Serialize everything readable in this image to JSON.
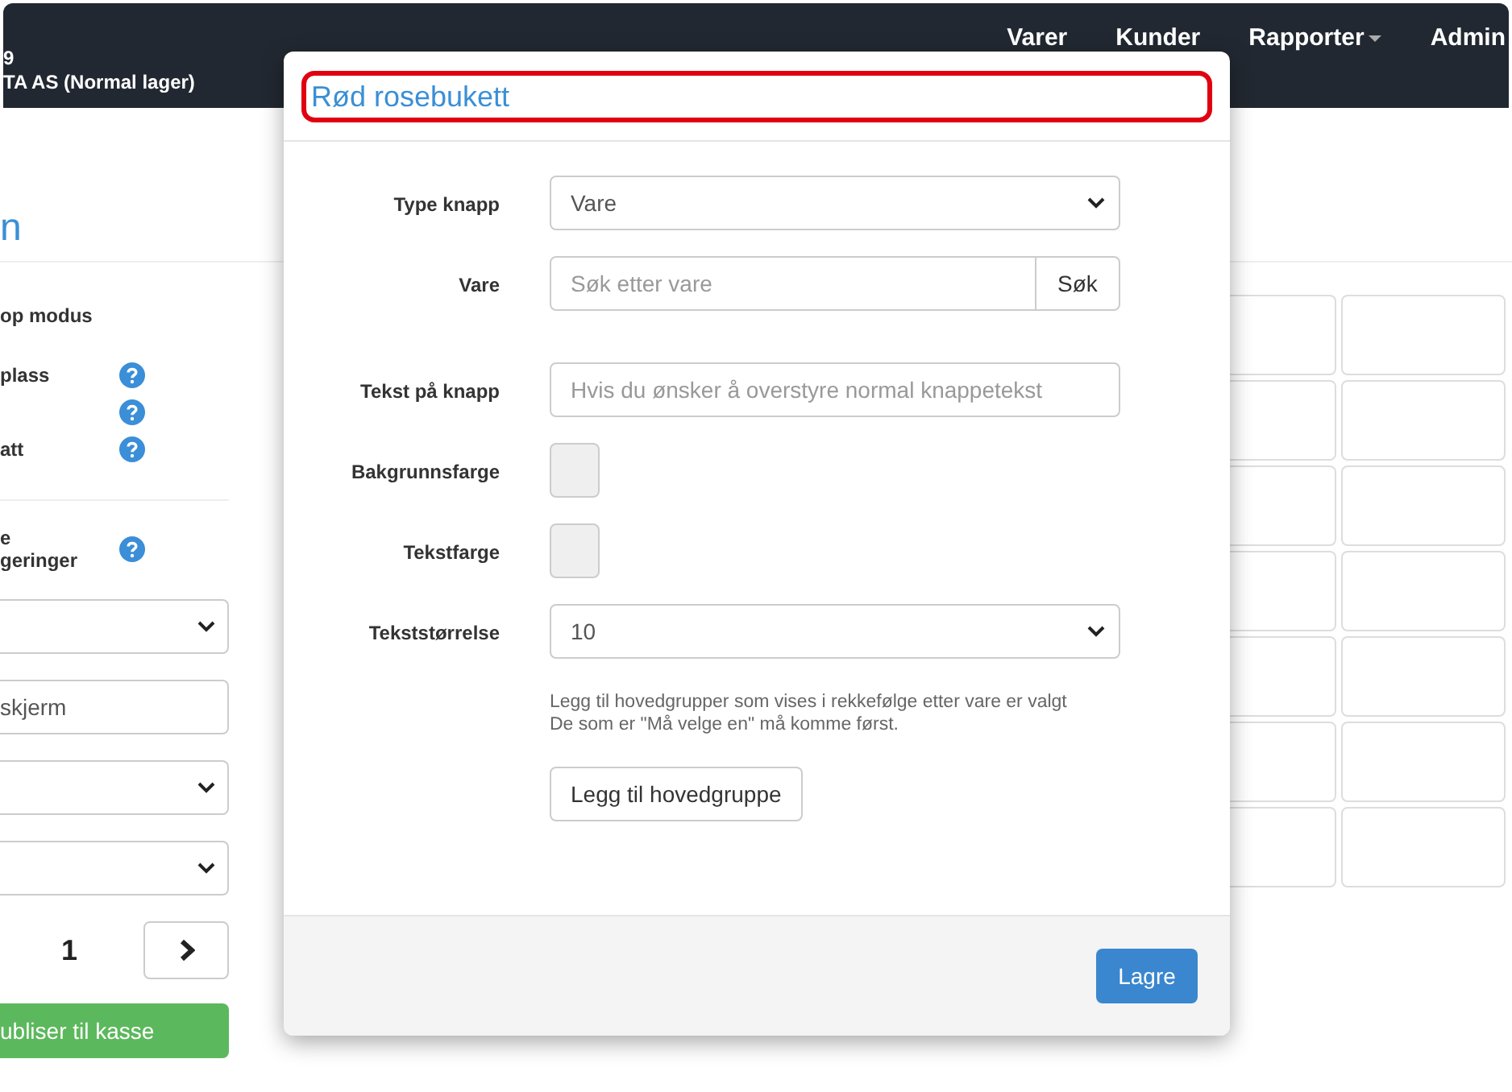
{
  "navbar": {
    "brand_lines": [
      "9",
      "TA AS (Normal lager)"
    ],
    "menu": [
      {
        "label": "Varer",
        "dropdown": false
      },
      {
        "label": "Kunder",
        "dropdown": false
      },
      {
        "label": "Rapporter",
        "dropdown": true
      },
      {
        "label": "Admin",
        "dropdown": false
      }
    ]
  },
  "sidebar": {
    "heading": "n",
    "mode_label": "op modus",
    "options": [
      {
        "kind": "labelled",
        "lines": [
          "plass"
        ]
      },
      {
        "kind": "unlabelled"
      },
      {
        "kind": "labelled",
        "lines": [
          "att"
        ]
      }
    ],
    "extra_option": {
      "kind": "labelled",
      "lines": [
        "e",
        "geringer"
      ]
    },
    "fields": [
      {
        "kind": "select"
      },
      {
        "kind": "input",
        "value": "skjerm"
      },
      {
        "kind": "select"
      },
      {
        "kind": "select"
      }
    ],
    "page": "1",
    "publish_button": "ubliser til kasse"
  },
  "modal": {
    "title": "Rød rosebukett",
    "highlighted": true,
    "fields": [
      {
        "kind": "select",
        "label": "Type knapp",
        "value": "Vare"
      },
      {
        "kind": "search",
        "label": "Vare",
        "placeholder": "Søk etter vare",
        "button": "Søk"
      },
      {
        "kind": "text",
        "label": "Tekst på knapp",
        "placeholder": "Hvis du ønsker å overstyre normal knappetekst"
      },
      {
        "kind": "color",
        "label": "Bakgrunnsfarge"
      },
      {
        "kind": "color",
        "label": "Tekstfarge"
      },
      {
        "kind": "select",
        "label": "Tekststørrelse",
        "value": "10"
      }
    ],
    "help_lines": [
      "Legg til hovedgrupper som vises i rekkefølge etter vare er valgt",
      "De som er \"Må velge en\" må komme først."
    ],
    "add_button": "Legg til hovedgruppe",
    "save_button": "Lagre"
  }
}
